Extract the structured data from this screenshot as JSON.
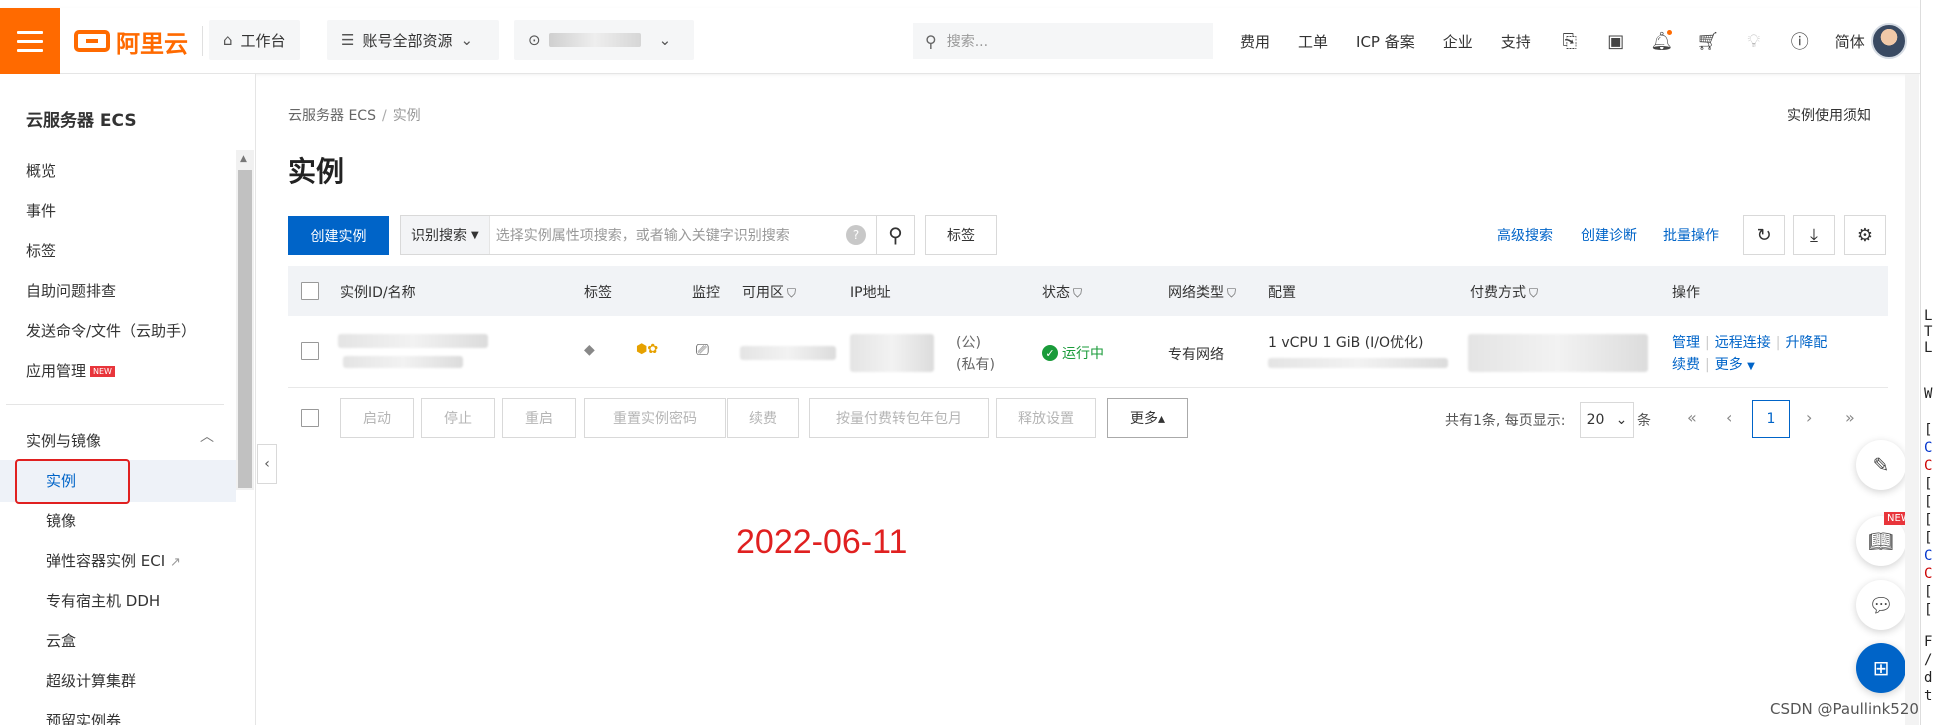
{
  "topbar": {
    "logo": "阿里云",
    "workbench": "工作台",
    "resources": "账号全部资源",
    "search_placeholder": "搜索...",
    "links": [
      "费用",
      "工单",
      "ICP 备案",
      "企业",
      "支持"
    ],
    "lang": "简体"
  },
  "sidebar": {
    "title": "云服务器 ECS",
    "items": [
      "概览",
      "事件",
      "标签",
      "自助问题排查",
      "发送命令/文件（云助手）",
      "应用管理"
    ],
    "new_badge": "NEW",
    "group": "实例与镜像",
    "sub_items": [
      "实例",
      "镜像",
      "弹性容器实例 ECI",
      "专有宿主机 DDH",
      "云盒",
      "超级计算集群",
      "预留实例券"
    ]
  },
  "main": {
    "breadcrumb": [
      "云服务器 ECS",
      "实例"
    ],
    "notice": "实例使用须知",
    "title": "实例",
    "create_button": "创建实例",
    "search_mode": "识别搜索",
    "search_placeholder": "选择实例属性项搜索，或者输入关键字识别搜索",
    "tag_button": "标签",
    "right_links": [
      "高级搜索",
      "创建诊断",
      "批量操作"
    ]
  },
  "table": {
    "headers": [
      "实例ID/名称",
      "标签",
      "监控",
      "可用区",
      "IP地址",
      "状态",
      "网络类型",
      "配置",
      "付费方式",
      "操作"
    ],
    "row": {
      "ip_public": "(公)",
      "ip_private": "(私有)",
      "status": "运行中",
      "network": "专有网络",
      "config": "1 vCPU 1 GiB   (I/O优化)",
      "actions": [
        "管理",
        "远程连接",
        "升降配"
      ],
      "actions2": [
        "续费",
        "更多"
      ]
    }
  },
  "bulk": {
    "buttons": [
      "启动",
      "停止",
      "重启",
      "重置实例密码",
      "续费",
      "按量付费转包年包月",
      "释放设置"
    ],
    "more": "更多▴"
  },
  "pager": {
    "summary": "共有1条, 每页显示:",
    "page_size": "20",
    "unit": "条",
    "current": "1"
  },
  "stamp": "2022-06-11",
  "watermark": "CSDN @Paullink520",
  "right_strip": [
    "L",
    "T",
    "L",
    "W",
    "[",
    "C",
    "C",
    "[",
    "[",
    "[",
    "[",
    "C",
    "C",
    "[",
    "[",
    "F",
    "/",
    "d",
    "t"
  ],
  "colors": {
    "brand": "#ff6a00",
    "primary": "#0064c8",
    "success": "#1a9b3a",
    "stamp": "#e02020"
  }
}
